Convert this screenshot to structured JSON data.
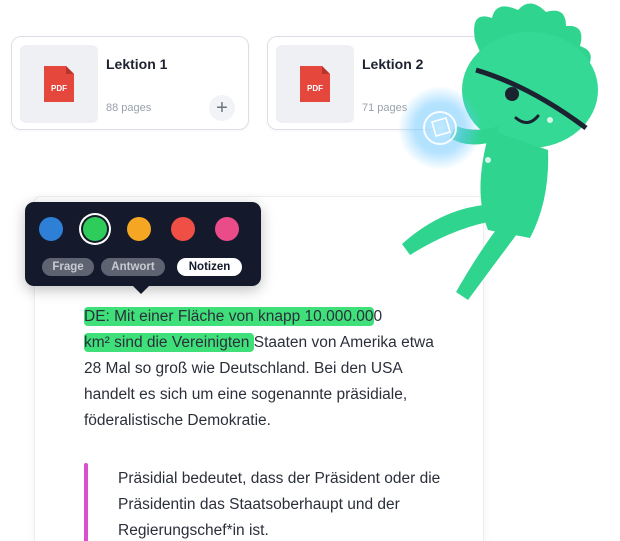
{
  "cards": [
    {
      "title": "Lektion 1",
      "pages": "88 pages",
      "file_badge": "PDF",
      "add_icon": "+"
    },
    {
      "title": "Lektion 2",
      "pages": "71 pages",
      "file_badge": "PDF"
    }
  ],
  "picker": {
    "colors": [
      {
        "name": "blue",
        "hex": "#2e7fd6"
      },
      {
        "name": "green",
        "hex": "#2ecc5a",
        "selected": true
      },
      {
        "name": "yellow",
        "hex": "#f5a623"
      },
      {
        "name": "red",
        "hex": "#ef4f45"
      },
      {
        "name": "pink",
        "hex": "#ea4c89"
      }
    ],
    "tags": [
      {
        "label": "Frage",
        "active": false
      },
      {
        "label": "Antwort",
        "active": false
      },
      {
        "label": "Notizen",
        "active": true
      }
    ]
  },
  "content": {
    "highlight_line_1": "DE: Mit einer Fläche von knapp 10.000.00",
    "highlight_line_1_rest": "0",
    "highlight_line_2": "km² sind die Vereinigten ",
    "paragraph_rest": "Staaten von Amerika etwa 28 Mal so groß wie Deutschland. Bei den USA handelt es sich um eine sogenannte präsidiale, föderalistische Demokratie.",
    "quote": "Präsidial bedeutet, dass der Präsident oder die Präsidentin das Staatsoberhaupt und der Regierungschef*in ist."
  },
  "colors": {
    "highlight": "#3fe07a",
    "quote_bar": "#d94fd0",
    "picker_bg": "#141a2b",
    "pdf_red": "#e5473c",
    "character": "#2fd58f"
  },
  "icons": {
    "pdf": "pdf-file-icon",
    "add": "plus-icon",
    "mascot": "green-character-illustration"
  }
}
